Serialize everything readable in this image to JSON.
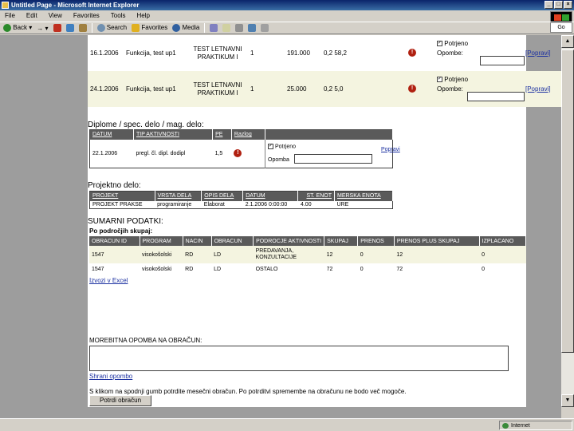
{
  "window": {
    "title": "Untitled Page - Microsoft Internet Explorer"
  },
  "menu": [
    "File",
    "Edit",
    "View",
    "Favorites",
    "Tools",
    "Help"
  ],
  "toolbar": {
    "back": "Back",
    "search": "Search",
    "favorites": "Favorites",
    "media": "Media"
  },
  "address": {
    "go": "Go"
  },
  "status": {
    "zone": "Internet"
  },
  "top_rows": [
    {
      "date": "16.1.2006",
      "activity": "Funkcija, test up1",
      "type": "TEST LETNAVNI PRAKTIKUM I",
      "pe": "1",
      "value1": "191.000",
      "value2": "0,2 58,2",
      "check_label": "Potrjeno",
      "note_label": "Opombe:",
      "link": "[Popravi]"
    },
    {
      "date": "24.1.2006",
      "activity": "Funkcija, test up1",
      "type": "TEST LETNAVNI PRAKTIKUM I",
      "pe": "1",
      "value1": "25.000",
      "value2": "0,2 5,0",
      "check_label": "Potrjeno",
      "note_label": "Opombe:",
      "link": "[Popravi]"
    }
  ],
  "diploma": {
    "title": "Diplome / spec. delo / mag. delo:",
    "headers": [
      "DATUM",
      "TIP AKTIVNOSTI",
      "PE",
      "Razlog"
    ],
    "row": {
      "date": "22.1.2006",
      "activity": "pregl. čl. dipl. dodipl",
      "pe": "1,5",
      "check_label": "Potrjeno",
      "note_label": "Opomba",
      "link": "Popravi"
    }
  },
  "project": {
    "title": "Projektno delo:",
    "headers": [
      "PROJEKT",
      "VRSTA DELA",
      "OPIS DELA",
      "DATUM",
      "ST. ENOT",
      "MERSKA ENOTA"
    ],
    "row": [
      "PROJEKT PRAKSE",
      "programiranje",
      "Elaborat",
      "2.1.2006 0:00:00",
      "4.00",
      "URE"
    ]
  },
  "summary": {
    "title": "SUMARNI PODATKI:",
    "subtitle": "Po področjih skupaj:",
    "headers": [
      "OBRACUN ID",
      "PROGRAM",
      "NACIN",
      "OBRACUN",
      "PODROCJE AKTIVNOSTI",
      "SKUPAJ",
      "PRENOS",
      "PRENOS PLUS SKUPAJ",
      "IZPLACANO"
    ],
    "rows": [
      [
        "1547",
        "visokošolski",
        "RD",
        "LD",
        "PREDAVANJA, KONZULTACIJE",
        "12",
        "0",
        "12",
        "0"
      ],
      [
        "1547",
        "visokošolski",
        "RD",
        "LD",
        "OSTALO",
        "72",
        "0",
        "72",
        "0"
      ]
    ],
    "excel_link": "Izvozi v Excel"
  },
  "note": {
    "label": "MOREBITNA OPOMBA NA OBRAČUN:",
    "save_link": "Shrani opombo"
  },
  "footer": {
    "text": "S klikom na spodnji gumb potrdite mesečni obračun. Po potrditvi spremembe na obračunu ne bodo več mogoče.",
    "confirm_button": "Potrdi obračun"
  }
}
